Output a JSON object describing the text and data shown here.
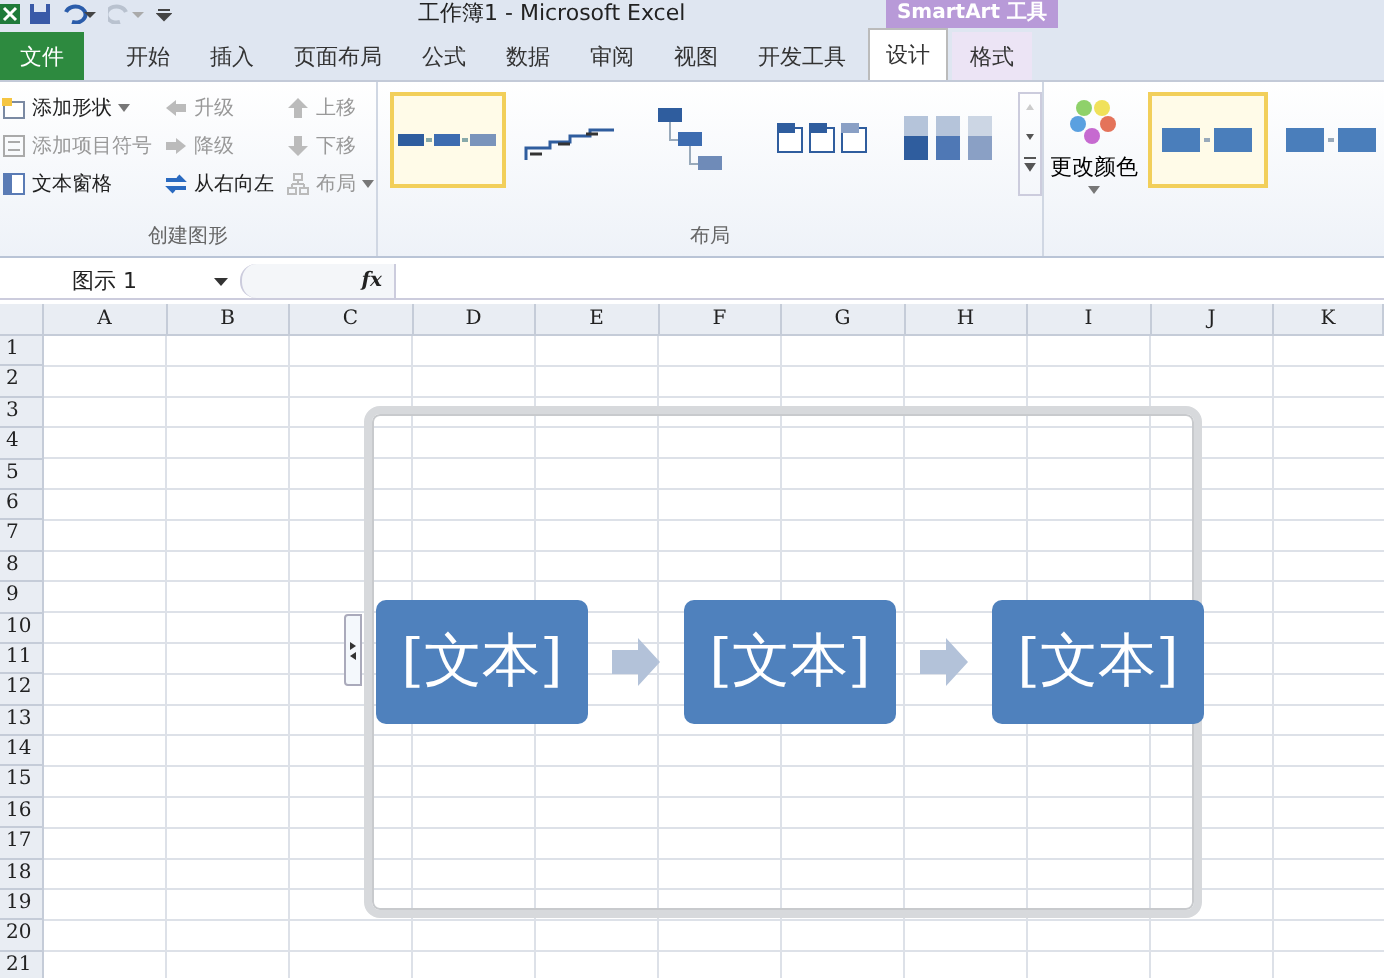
{
  "window": {
    "title": "工作簿1 - Microsoft Excel",
    "context_tab": "SmartArt 工具"
  },
  "tabs": [
    {
      "label": "文件",
      "kind": "file",
      "selected": false
    },
    {
      "label": "开始",
      "kind": "normal",
      "selected": false
    },
    {
      "label": "插入",
      "kind": "normal",
      "selected": false
    },
    {
      "label": "页面布局",
      "kind": "normal",
      "selected": false
    },
    {
      "label": "公式",
      "kind": "normal",
      "selected": false
    },
    {
      "label": "数据",
      "kind": "normal",
      "selected": false
    },
    {
      "label": "审阅",
      "kind": "normal",
      "selected": false
    },
    {
      "label": "视图",
      "kind": "normal",
      "selected": false
    },
    {
      "label": "开发工具",
      "kind": "normal",
      "selected": false
    },
    {
      "label": "设计",
      "kind": "context",
      "selected": true
    },
    {
      "label": "格式",
      "kind": "context",
      "selected": false
    }
  ],
  "create_group": {
    "label": "创建图形",
    "columns": [
      [
        {
          "label": "添加形状",
          "dropdown": true,
          "disabled": false
        },
        {
          "label": "添加项目符号",
          "dropdown": false,
          "disabled": true
        },
        {
          "label": "文本窗格",
          "dropdown": false,
          "disabled": false
        }
      ],
      [
        {
          "label": "升级",
          "dropdown": false,
          "disabled": true
        },
        {
          "label": "降级",
          "dropdown": false,
          "disabled": true
        },
        {
          "label": "从右向左",
          "dropdown": false,
          "disabled": false
        }
      ],
      [
        {
          "label": "上移",
          "dropdown": false,
          "disabled": true
        },
        {
          "label": "下移",
          "dropdown": false,
          "disabled": true
        },
        {
          "label": "布局",
          "dropdown": true,
          "disabled": true
        }
      ]
    ]
  },
  "layout_group": {
    "label": "布局",
    "options": [
      {
        "selected": true
      },
      {
        "selected": false
      },
      {
        "selected": false
      },
      {
        "selected": false
      },
      {
        "selected": false
      }
    ]
  },
  "colors_button": {
    "label": "更改颜色"
  },
  "style_options": [
    {
      "selected": true
    },
    {
      "selected": false
    }
  ],
  "formula_bar": {
    "name_box": "图示 1",
    "fx": "fx"
  },
  "columns": [
    "A",
    "B",
    "C",
    "D",
    "E",
    "F",
    "G",
    "H",
    "I",
    "J",
    "K"
  ],
  "rows": [
    "1",
    "2",
    "3",
    "4",
    "5",
    "6",
    "7",
    "8",
    "9",
    "10",
    "11",
    "12",
    "13",
    "14",
    "15",
    "16",
    "17",
    "18",
    "19",
    "20",
    "21"
  ],
  "diagram": {
    "nodes": [
      "[文本]",
      "[文本]",
      "[文本]"
    ]
  }
}
